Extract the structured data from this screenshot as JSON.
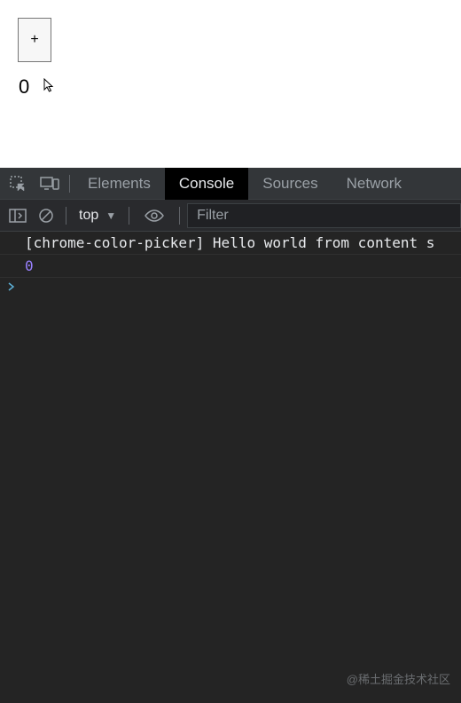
{
  "page": {
    "button_label": "+",
    "counter_value": "0"
  },
  "devtools": {
    "tabs": {
      "elements": "Elements",
      "console": "Console",
      "sources": "Sources",
      "network": "Network"
    },
    "active_tab": "console",
    "toolbar": {
      "context": "top",
      "filter_placeholder": "Filter"
    },
    "console": {
      "lines": [
        {
          "type": "log",
          "text": "[chrome-color-picker] Hello world from content s"
        },
        {
          "type": "number",
          "text": "0"
        }
      ]
    }
  },
  "watermark": "@稀土掘金技术社区",
  "icons": {
    "inspect": "inspect-icon",
    "device": "device-toolbar-icon",
    "sidebar": "sidebar-toggle-icon",
    "clear": "clear-console-icon",
    "eye": "live-expression-icon",
    "chevron": "chevron-down-icon",
    "prompt": "prompt-icon"
  }
}
